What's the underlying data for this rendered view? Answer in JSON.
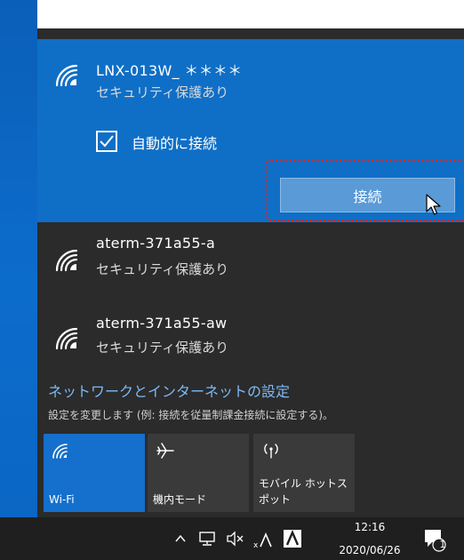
{
  "networks": [
    {
      "name": "LNX-013W_ ＊＊＊＊",
      "security": "セキュリティ保護あり"
    },
    {
      "name": "aterm-371a55-a",
      "security": "セキュリティ保護あり"
    },
    {
      "name": "aterm-371a55-aw",
      "security": "セキュリティ保護あり"
    }
  ],
  "selected": {
    "auto_connect_label": "自動的に接続",
    "auto_connect_checked": true,
    "connect_button": "接続"
  },
  "settings": {
    "link": "ネットワークとインターネットの設定",
    "description": "設定を変更します (例: 接続を従量制課金接続に設定する)。"
  },
  "tiles": [
    {
      "label_line1": "Wi-Fi",
      "label_line2": "",
      "active": true,
      "icon": "wifi-icon"
    },
    {
      "label_line1": "機内モード",
      "label_line2": "",
      "active": false,
      "icon": "airplane-icon"
    },
    {
      "label_line1": "モバイル ホットス",
      "label_line2": "ポット",
      "active": false,
      "icon": "hotspot-icon"
    }
  ],
  "taskbar": {
    "time": "12:16",
    "date": "2020/06/26",
    "notification_count": "1"
  },
  "colors": {
    "accent": "#0f6fc6",
    "flyout_bg": "#2b2b2b",
    "link": "#7cbaf7",
    "highlight": "#e02020"
  }
}
